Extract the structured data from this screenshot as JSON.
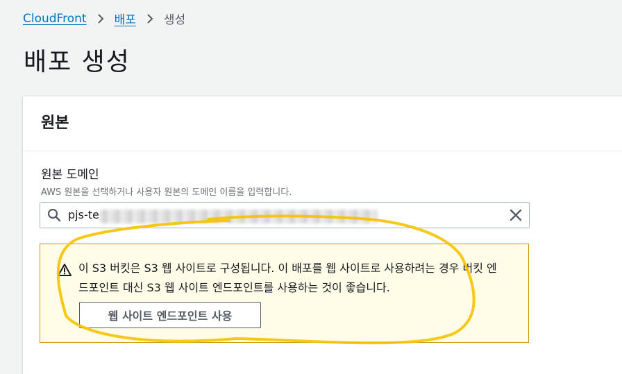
{
  "breadcrumb": {
    "items": [
      "CloudFront",
      "배포"
    ],
    "current": "생성"
  },
  "page": {
    "title": "배포 생성"
  },
  "origin_panel": {
    "title": "원본",
    "domain_label": "원본 도메인",
    "domain_description": "AWS 원본을 선택하거나 사용자 원본의 도메인 이름을 입력합니다.",
    "domain_value": "pjs-te"
  },
  "alert": {
    "message": "이 S3 버킷은 S3 웹 사이트로 구성됩니다. 이 배포를 웹 사이트로 사용하려는 경우 버킷 엔드포인트 대신 S3 웹 사이트 엔드포인트를 사용하는 것이 좋습니다.",
    "button_label": "웹 사이트 엔드포인트 사용",
    "type": "warning"
  },
  "icons": {
    "search": "search-icon",
    "clear": "close-icon",
    "warning": "warning-icon",
    "chevron": "chevron-right-icon"
  },
  "colors": {
    "link": "#0073bb",
    "warning_border": "#c49a00",
    "warning_bg": "#fffce7",
    "annotation": "#f5c200"
  }
}
